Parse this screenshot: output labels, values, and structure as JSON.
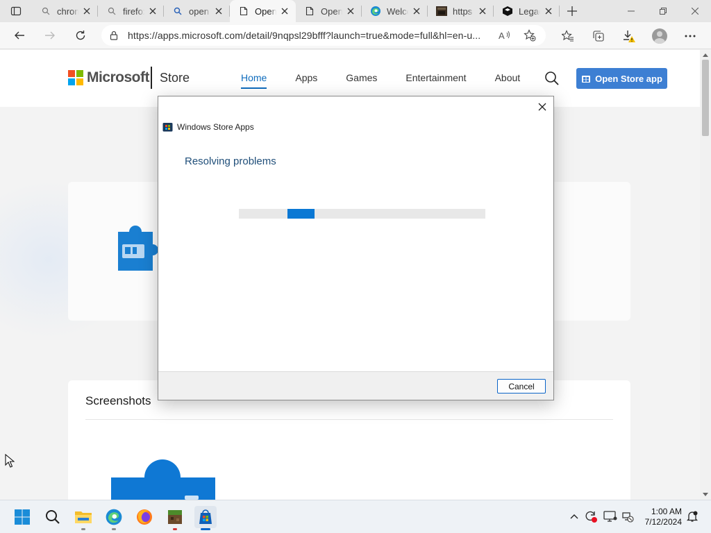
{
  "browser": {
    "tabs": [
      {
        "title": "chrome",
        "icon": "search-icon",
        "active": false
      },
      {
        "title": "firefox",
        "icon": "search-icon",
        "active": false
      },
      {
        "title": "open",
        "icon": "search-icon",
        "active": false
      },
      {
        "title": "Open",
        "icon": "page-icon",
        "active": true
      },
      {
        "title": "Open",
        "icon": "page-icon",
        "active": false
      },
      {
        "title": "Welcome",
        "icon": "edge-icon",
        "active": false
      },
      {
        "title": "https",
        "icon": "image-thumb-icon",
        "active": false
      },
      {
        "title": "Legacy",
        "icon": "shield-logo-icon",
        "active": false
      }
    ],
    "url": "https://apps.microsoft.com/detail/9nqpsl29bfff?launch=true&mode=full&hl=en-u..."
  },
  "store": {
    "brand": "Microsoft",
    "section": "Store",
    "nav": [
      "Home",
      "Apps",
      "Games",
      "Entertainment",
      "About"
    ],
    "active_nav": "Home",
    "open_app_label": "Open Store app",
    "screenshots_title": "Screenshots"
  },
  "dialog": {
    "caption": "Windows Store Apps",
    "heading": "Resolving problems",
    "progress_fraction": 0.2,
    "cancel_label": "Cancel"
  },
  "taskbar": {
    "time": "1:00 AM",
    "date": "7/12/2024"
  },
  "colors": {
    "accent": "#0a78d4",
    "store_button": "#3d7fd3",
    "ms_red": "#f25022",
    "ms_green": "#7fba00",
    "ms_blue": "#00a4ef",
    "ms_yellow": "#ffb900"
  }
}
